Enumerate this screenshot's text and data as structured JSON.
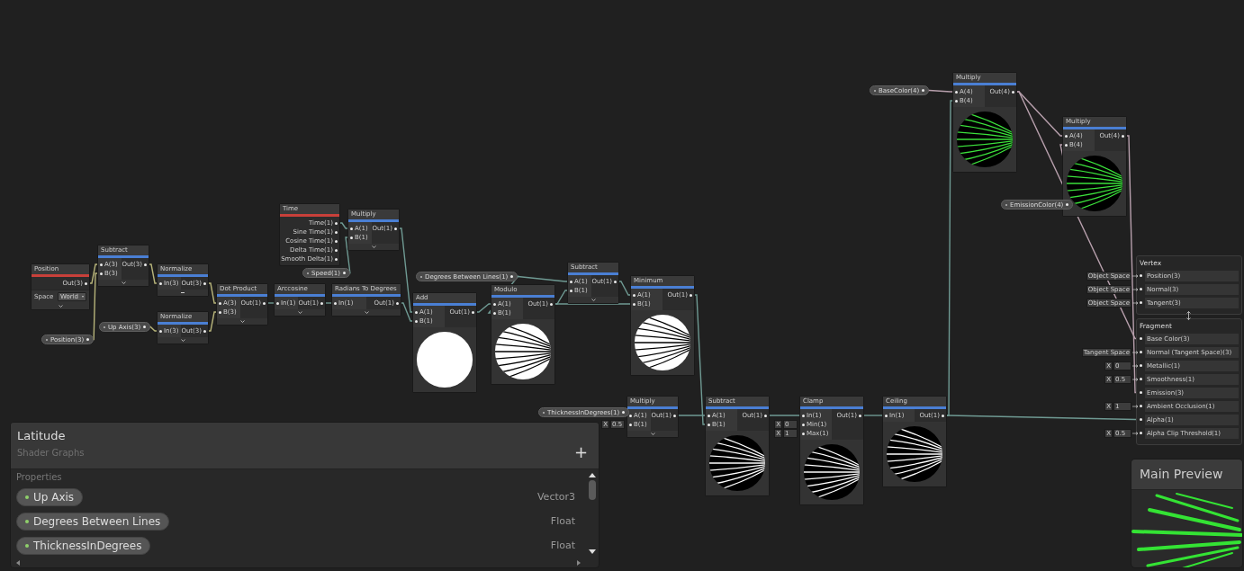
{
  "graph": {
    "nodes": [
      {
        "title": "Position",
        "color": "#c8403a",
        "outputs": [
          "Out(3)"
        ],
        "options": [
          {
            "label": "Space",
            "value": "World"
          }
        ],
        "expanded": false
      },
      {
        "title": "Subtract",
        "color": "#4a7fd4",
        "inputs": [
          {
            "label": "A(3)"
          },
          {
            "label": "B(3)"
          }
        ],
        "outputs": [
          "Out(3)"
        ],
        "expanded": false
      },
      {
        "title": "Normalize",
        "color": "#4a7fd4",
        "inputs": [
          {
            "label": "In(3)"
          }
        ],
        "outputs": [
          "Out(3)"
        ],
        "expanded": true
      },
      {
        "title": "Normalize",
        "color": "#4a7fd4",
        "inputs": [
          {
            "label": "In(3)"
          }
        ],
        "outputs": [
          "Out(3)"
        ],
        "expanded": false
      },
      {
        "title": "Dot Product",
        "color": "#4a7fd4",
        "inputs": [
          {
            "label": "A(3)"
          },
          {
            "label": "B(3)"
          }
        ],
        "outputs": [
          "Out(1)"
        ],
        "expanded": false
      },
      {
        "title": "Arccosine",
        "color": "#4a7fd4",
        "inputs": [
          {
            "label": "In(1)"
          }
        ],
        "outputs": [
          "Out(1)"
        ],
        "expanded": false
      },
      {
        "title": "Radians To Degrees",
        "color": "#4a7fd4",
        "inputs": [
          {
            "label": "In(1)"
          }
        ],
        "outputs": [
          "Out(1)"
        ],
        "expanded": false
      },
      {
        "title": "Time",
        "color": "#c8403a",
        "outputs": [
          "Time(1)",
          "Sine Time(1)",
          "Cosine Time(1)",
          "Delta Time(1)",
          "Smooth Delta(1)"
        ]
      },
      {
        "title": "Multiply",
        "color": "#4a7fd4",
        "inputs": [
          {
            "label": "A(1)"
          },
          {
            "label": "B(1)"
          }
        ],
        "outputs": [
          "Out(1)"
        ],
        "expanded": false
      },
      {
        "title": "Add",
        "color": "#4a7fd4",
        "inputs": [
          {
            "label": "A(1)"
          },
          {
            "label": "B(1)"
          }
        ],
        "outputs": [
          "Out(1)"
        ],
        "preview": {
          "kind": "solid"
        }
      },
      {
        "title": "Modulo",
        "color": "#4a7fd4",
        "inputs": [
          {
            "label": "A(1)"
          },
          {
            "label": "B(1)"
          }
        ],
        "outputs": [
          "Out(1)"
        ],
        "preview": {
          "kind": "inked"
        }
      },
      {
        "title": "Subtract",
        "color": "#4a7fd4",
        "inputs": [
          {
            "label": "A(1)"
          },
          {
            "label": "B(1)"
          }
        ],
        "outputs": [
          "Out(1)"
        ],
        "expanded": false
      },
      {
        "title": "Minimum",
        "color": "#4a7fd4",
        "inputs": [
          {
            "label": "A(1)"
          },
          {
            "label": "B(1)"
          }
        ],
        "outputs": [
          "Out(1)"
        ],
        "preview": {
          "kind": "inked"
        }
      },
      {
        "title": "Multiply",
        "color": "#4a7fd4",
        "inputs": [
          {
            "label": "A(1)"
          },
          {
            "label": "B(1)",
            "default": {
              "axis": "X",
              "value": "0.5"
            }
          }
        ],
        "outputs": [
          "Out(1)"
        ],
        "expanded": false
      },
      {
        "title": "Subtract",
        "color": "#4a7fd4",
        "inputs": [
          {
            "label": "A(1)"
          },
          {
            "label": "B(1)"
          }
        ],
        "outputs": [
          "Out(1)"
        ],
        "preview": {
          "kind": "striped"
        }
      },
      {
        "title": "Clamp",
        "color": "#4a7fd4",
        "inputs": [
          {
            "label": "In(1)"
          },
          {
            "label": "Min(1)",
            "default": {
              "axis": "X",
              "value": "0"
            }
          },
          {
            "label": "Max(1)",
            "default": {
              "axis": "X",
              "value": "1"
            }
          }
        ],
        "outputs": [
          "Out(1)"
        ],
        "preview": {
          "kind": "striped"
        }
      },
      {
        "title": "Ceiling",
        "color": "#4a7fd4",
        "inputs": [
          {
            "label": "In(1)"
          }
        ],
        "outputs": [
          "Out(1)"
        ],
        "preview": {
          "kind": "striped"
        }
      },
      {
        "title": "Multiply",
        "color": "#4a7fd4",
        "inputs": [
          {
            "label": "A(4)"
          },
          {
            "label": "B(4)"
          }
        ],
        "outputs": [
          "Out(4)"
        ],
        "preview": {
          "kind": "glowing"
        }
      },
      {
        "title": "Multiply",
        "color": "#4a7fd4",
        "inputs": [
          {
            "label": "A(4)"
          },
          {
            "label": "B(4)"
          }
        ],
        "outputs": [
          "Out(4)"
        ],
        "preview": {
          "kind": "glowing"
        }
      }
    ],
    "properties": [
      {
        "label": "Position(3)"
      },
      {
        "label": "Up Axis(3)"
      },
      {
        "label": "Speed(1)"
      },
      {
        "label": "Degrees Between Lines(1)"
      },
      {
        "label": "ThicknessInDegrees(1)"
      },
      {
        "label": "BaseColor(4)"
      },
      {
        "label": "EmissionColor(4)"
      }
    ],
    "master": {
      "blocks": [
        {
          "title": "Vertex",
          "slots": [
            {
              "label": "Position(3)",
              "input": {
                "kind": "space",
                "value": "Object Space"
              }
            },
            {
              "label": "Normal(3)",
              "input": {
                "kind": "space",
                "value": "Object Space"
              }
            },
            {
              "label": "Tangent(3)",
              "input": {
                "kind": "space",
                "value": "Object Space"
              }
            }
          ]
        },
        {
          "title": "Fragment",
          "slots": [
            {
              "label": "Base Color(3)"
            },
            {
              "label": "Normal (Tangent Space)(3)",
              "input": {
                "kind": "space",
                "value": "Tangent Space"
              }
            },
            {
              "label": "Metallic(1)",
              "input": {
                "kind": "value",
                "axis": "X",
                "value": "0"
              }
            },
            {
              "label": "Smoothness(1)",
              "input": {
                "kind": "value",
                "axis": "X",
                "value": "0.5"
              }
            },
            {
              "label": "Emission(3)"
            },
            {
              "label": "Ambient Occlusion(1)",
              "input": {
                "kind": "value",
                "axis": "X",
                "value": "1"
              }
            },
            {
              "label": "Alpha(1)"
            },
            {
              "label": "Alpha Clip Threshold(1)",
              "input": {
                "kind": "value",
                "axis": "X",
                "value": "0.5"
              }
            }
          ]
        }
      ]
    }
  },
  "blackboard": {
    "title": "Latitude",
    "subtitle": "Shader Graphs",
    "add_label": "+",
    "section": "Properties",
    "properties": [
      {
        "name": "Up Axis",
        "type": "Vector3"
      },
      {
        "name": "Degrees Between Lines",
        "type": "Float"
      },
      {
        "name": "ThicknessInDegrees",
        "type": "Float"
      }
    ]
  },
  "main_preview": {
    "title": "Main Preview",
    "preview": {
      "kind": "glowing"
    }
  }
}
